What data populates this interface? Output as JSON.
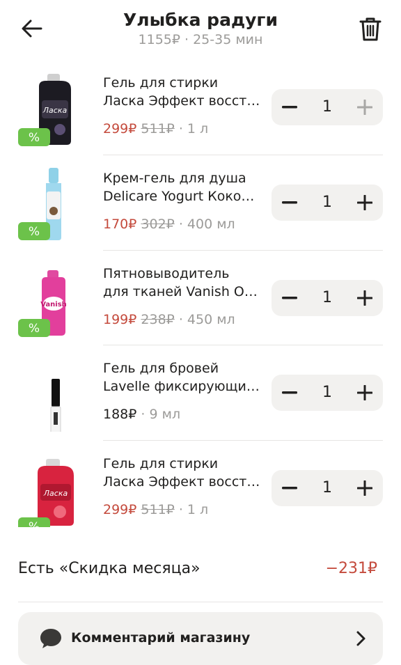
{
  "header": {
    "title": "Улыбка радуги",
    "subtitle": "1155₽ · 25-35 мин",
    "back_icon": "arrow-left-icon",
    "trash_icon": "trash-icon"
  },
  "items": [
    {
      "name_line1": "Гель для стирки",
      "name_line2": "Ласка Эффект восст…",
      "price": "299₽",
      "old_price": "511₽",
      "volume": "· 1 л",
      "qty": "1",
      "has_discount_badge": true,
      "badge": "%",
      "plus_disabled": true
    },
    {
      "name_line1": "Крем-гель для душа",
      "name_line2": "Delicare Yogurt Коко…",
      "price": "170₽",
      "old_price": "302₽",
      "volume": "· 400 мл",
      "qty": "1",
      "has_discount_badge": true,
      "badge": "%",
      "plus_disabled": false
    },
    {
      "name_line1": "Пятновыводитель",
      "name_line2": "для тканей Vanish О…",
      "price": "199₽",
      "old_price": "238₽",
      "volume": "· 450 мл",
      "qty": "1",
      "has_discount_badge": true,
      "badge": "%",
      "plus_disabled": false
    },
    {
      "name_line1": "Гель для бровей",
      "name_line2": "Lavelle фиксирующи…",
      "price": "188₽",
      "old_price": "",
      "volume": "· 9 мл",
      "qty": "1",
      "has_discount_badge": false,
      "badge": "",
      "plus_disabled": false
    },
    {
      "name_line1": "Гель для стирки",
      "name_line2": "Ласка Эффект восст…",
      "price": "299₽",
      "old_price": "511₽",
      "volume": "· 1 л",
      "qty": "1",
      "has_discount_badge": true,
      "badge": "%",
      "plus_disabled": false
    }
  ],
  "discount": {
    "label": "Есть «Скидка месяца»",
    "value": "−231₽"
  },
  "comment": {
    "label": "Комментарий магазину",
    "icon": "speech-bubble-icon",
    "chevron_icon": "chevron-right-icon"
  },
  "colors": {
    "accent_red": "#c44a3c",
    "badge_green": "#6cc24a",
    "muted": "#9c9b99",
    "surface": "#f2f1ef"
  }
}
